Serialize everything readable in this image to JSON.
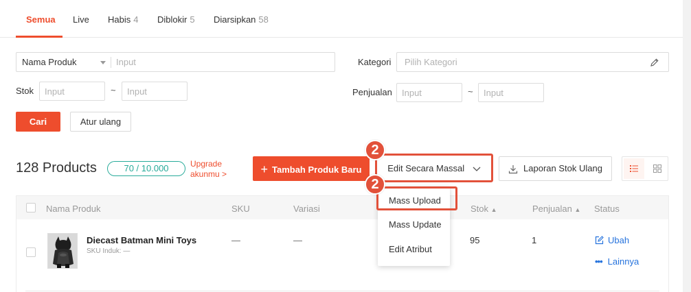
{
  "tabs": [
    {
      "label": "Semua",
      "count": ""
    },
    {
      "label": "Live",
      "count": ""
    },
    {
      "label": "Habis",
      "count": "4"
    },
    {
      "label": "Diblokir",
      "count": "5"
    },
    {
      "label": "Diarsipkan",
      "count": "58"
    }
  ],
  "filters": {
    "product_select_value": "Nama Produk",
    "product_input_placeholder": "Input",
    "kategori_label": "Kategori",
    "kategori_placeholder": "Pilih Kategori",
    "stok_label": "Stok",
    "stok_min_placeholder": "Input",
    "stok_max_placeholder": "Input",
    "range_sep": "~",
    "penjualan_label": "Penjualan",
    "penjualan_min_placeholder": "Input",
    "penjualan_max_placeholder": "Input",
    "search_button": "Cari",
    "reset_button": "Atur ulang"
  },
  "toolbar": {
    "products_count": "128 Products",
    "quota": "70 / 10.000",
    "upgrade_line1": "Upgrade",
    "upgrade_line2": "akunmu >",
    "add_product_button": "Tambah Produk Baru",
    "mass_edit_button": "Edit Secara Massal",
    "stock_report_button": "Laporan Stok Ulang",
    "badge_top": "2",
    "badge_bottom": "2"
  },
  "dropdown": {
    "items": [
      "Mass Upload",
      "Mass Update",
      "Edit Atribut"
    ]
  },
  "table": {
    "headers": {
      "name": "Nama Produk",
      "sku": "SKU",
      "variasi": "Variasi",
      "stok": "Stok",
      "penjualan": "Penjualan",
      "status": "Status"
    },
    "rows": [
      {
        "name": "Diecast Batman Mini Toys",
        "sku_parent": "SKU Induk: —",
        "sku": "—",
        "variasi": "—",
        "stok": "95",
        "penjualan": "1",
        "action_edit": "Ubah",
        "action_more": "Lainnya"
      }
    ]
  },
  "colors": {
    "brand": "#ee4d2d",
    "quota": "#26aa99",
    "link": "#2673dd",
    "highlight": "#e2513a"
  }
}
